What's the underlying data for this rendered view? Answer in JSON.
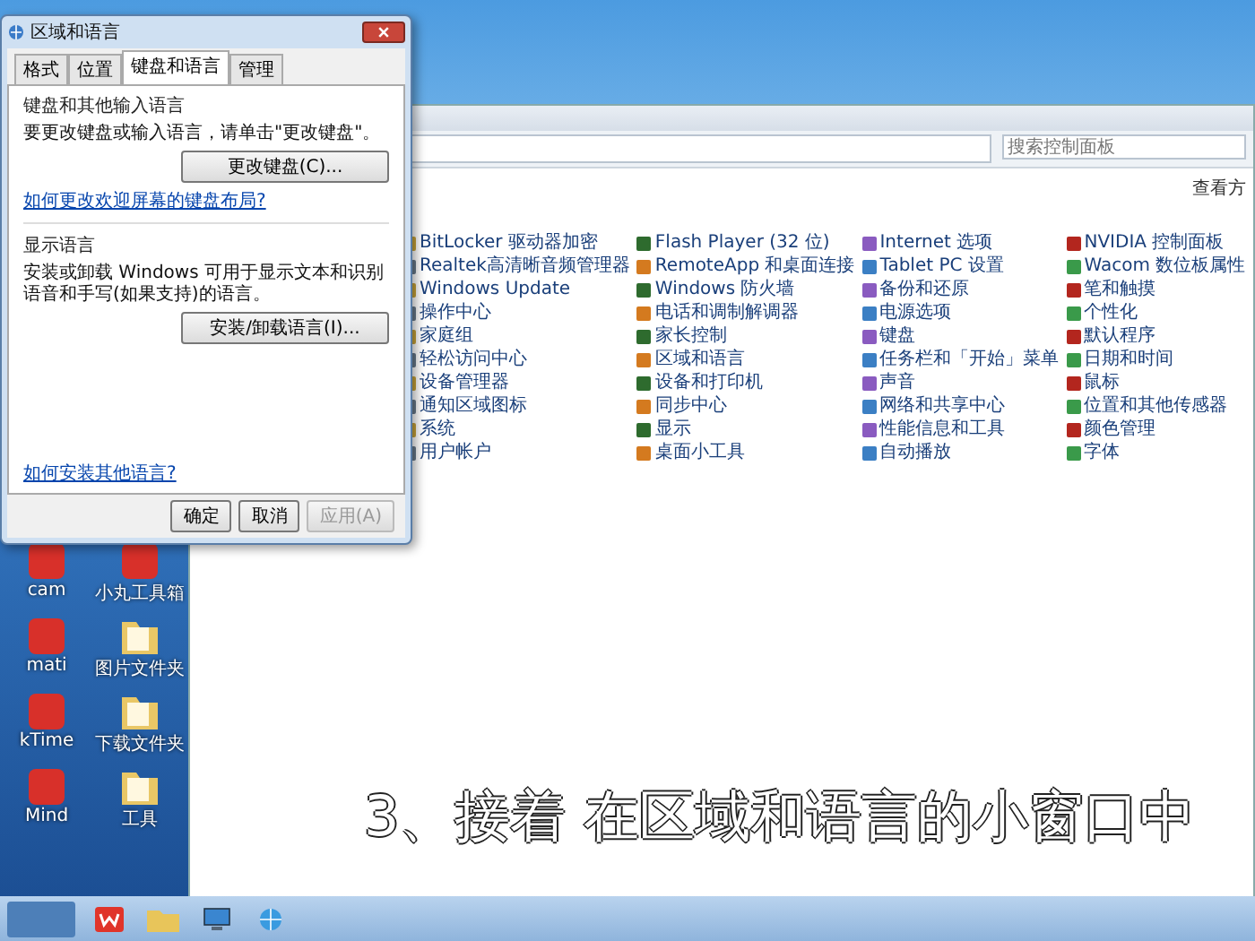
{
  "dialog": {
    "title": "区域和语言",
    "tabs": [
      {
        "label": "格式",
        "selected": false
      },
      {
        "label": "位置",
        "selected": false
      },
      {
        "label": "键盘和语言",
        "selected": true
      },
      {
        "label": "管理",
        "selected": false
      }
    ],
    "keyboard_group": {
      "heading": "键盘和其他输入语言",
      "text": "要更改键盘或输入语言，请单击\"更改键盘\"。",
      "button": "更改键盘(C)..."
    },
    "keyboard_link": "如何更改欢迎屏幕的键盘布局?",
    "display_group": {
      "heading": "显示语言",
      "text": "安装或卸载 Windows 可用于显示文本和识别语音和手写(如果支持)的语言。",
      "button": "安装/卸载语言(I)..."
    },
    "help_link": "如何安装其他语言?",
    "buttons": [
      {
        "label": "确定",
        "disabled": false
      },
      {
        "label": "取消",
        "disabled": false
      },
      {
        "label": "应用(A)",
        "disabled": true
      }
    ]
  },
  "control_panel": {
    "search": {
      "placeholder": "搜索控制面板"
    },
    "view_label": "查看方",
    "items": [
      {
        "label": "BitLocker 驱动器加密"
      },
      {
        "label": "Flash Player (32 位)"
      },
      {
        "label": "Internet 选项"
      },
      {
        "label": "NVIDIA 控制面板"
      },
      {
        "label": "Realtek高清晰音频管理器"
      },
      {
        "label": "RemoteApp 和桌面连接"
      },
      {
        "label": "Tablet PC 设置"
      },
      {
        "label": "Wacom 数位板属性"
      },
      {
        "label": "Windows Update"
      },
      {
        "label": "Windows 防火墙"
      },
      {
        "label": "备份和还原"
      },
      {
        "label": "笔和触摸"
      },
      {
        "label": "操作中心"
      },
      {
        "label": "电话和调制解调器"
      },
      {
        "label": "电源选项"
      },
      {
        "label": "个性化"
      },
      {
        "label": "家庭组"
      },
      {
        "label": "家长控制"
      },
      {
        "label": "键盘"
      },
      {
        "label": "默认程序"
      },
      {
        "label": "轻松访问中心"
      },
      {
        "label": "区域和语言"
      },
      {
        "label": "任务栏和「开始」菜单"
      },
      {
        "label": "日期和时间"
      },
      {
        "label": "设备管理器"
      },
      {
        "label": "设备和打印机"
      },
      {
        "label": "声音"
      },
      {
        "label": "鼠标"
      },
      {
        "label": "通知区域图标"
      },
      {
        "label": "同步中心"
      },
      {
        "label": "网络和共享中心"
      },
      {
        "label": "位置和其他传感器"
      },
      {
        "label": "系统"
      },
      {
        "label": "显示"
      },
      {
        "label": "性能信息和工具"
      },
      {
        "label": "颜色管理"
      },
      {
        "label": "用户帐户"
      },
      {
        "label": "桌面小工具"
      },
      {
        "label": "自动播放"
      },
      {
        "label": "字体"
      }
    ]
  },
  "desktop_icons": [
    {
      "label": "cam",
      "kind": "app"
    },
    {
      "label": "小丸工具箱",
      "kind": "app"
    },
    {
      "label": "mati",
      "kind": "app"
    },
    {
      "label": "图片文件夹",
      "kind": "folder"
    },
    {
      "label": "kTime",
      "kind": "app"
    },
    {
      "label": "下载文件夹",
      "kind": "folder"
    },
    {
      "label": "Mind",
      "kind": "app"
    },
    {
      "label": "工具",
      "kind": "folder"
    }
  ],
  "subtitle": "3、接着 在区域和语言的小窗口中"
}
